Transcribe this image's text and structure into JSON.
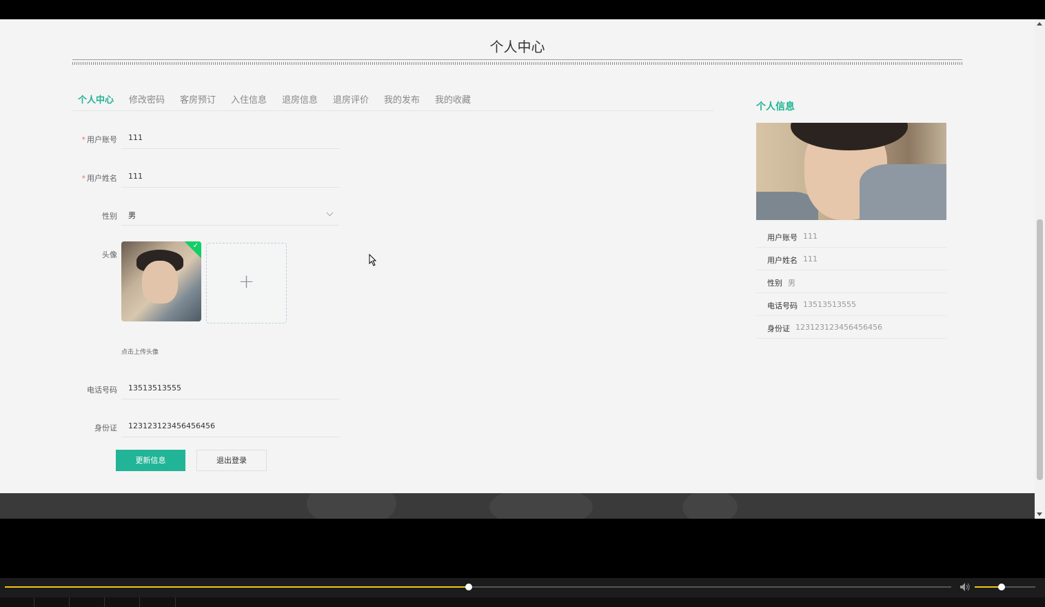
{
  "page": {
    "title": "个人中心"
  },
  "tabs": [
    {
      "label": "个人中心",
      "active": true
    },
    {
      "label": "修改密码",
      "active": false
    },
    {
      "label": "客房预订",
      "active": false
    },
    {
      "label": "入住信息",
      "active": false
    },
    {
      "label": "退房信息",
      "active": false
    },
    {
      "label": "退房评价",
      "active": false
    },
    {
      "label": "我的发布",
      "active": false
    },
    {
      "label": "我的收藏",
      "active": false
    }
  ],
  "form": {
    "account_label": "用户账号",
    "account_value": "111",
    "name_label": "用户姓名",
    "name_value": "111",
    "gender_label": "性别",
    "gender_value": "男",
    "avatar_label": "头像",
    "upload_plus": "+",
    "upload_tip": "点击上传头像",
    "phone_label": "电话号码",
    "phone_value": "13513513555",
    "id_label": "身份证",
    "id_value": "123123123456456456",
    "required_mark": "*",
    "check_mark": "✓"
  },
  "buttons": {
    "update": "更新信息",
    "logout": "退出登录"
  },
  "side": {
    "title": "个人信息",
    "rows": [
      {
        "key": "用户账号",
        "value": "111"
      },
      {
        "key": "用户姓名",
        "value": "111"
      },
      {
        "key": "性别",
        "value": "男"
      },
      {
        "key": "电话号码",
        "value": "13513513555"
      },
      {
        "key": "身份证",
        "value": "123123123456456456"
      }
    ]
  },
  "player": {
    "progress": 0.49,
    "volume": 0.45
  },
  "colors": {
    "accent": "#1fb395",
    "button": "#22b497",
    "progress": "#f5c518"
  }
}
